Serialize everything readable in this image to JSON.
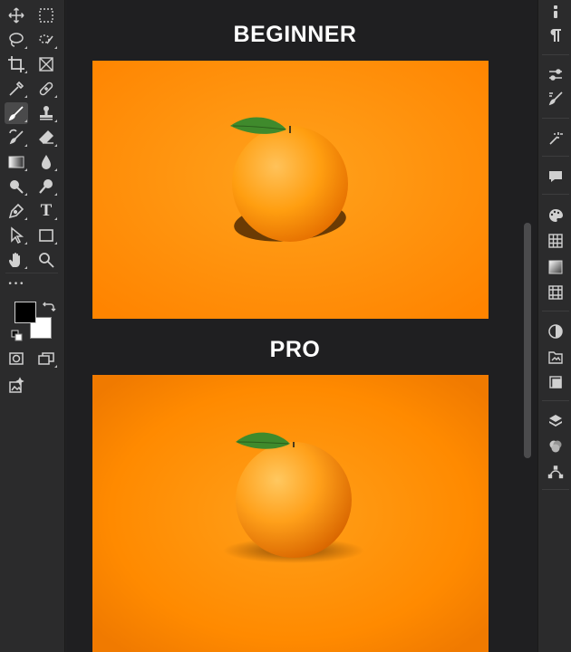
{
  "headings": {
    "beginner": "BEGINNER",
    "pro": "PRO"
  },
  "colors": {
    "canvas_orange": "#ff8a00",
    "foreground": "#000000",
    "background": "#ffffff"
  },
  "toolbar": {
    "tools": [
      {
        "name": "move-tool-icon"
      },
      {
        "name": "rectangular-marquee-icon"
      },
      {
        "name": "lasso-icon"
      },
      {
        "name": "quick-selection-icon"
      },
      {
        "name": "crop-icon"
      },
      {
        "name": "frame-icon"
      },
      {
        "name": "eyedropper-icon"
      },
      {
        "name": "healing-brush-icon"
      },
      {
        "name": "brush-icon"
      },
      {
        "name": "clone-stamp-icon"
      },
      {
        "name": "history-brush-icon"
      },
      {
        "name": "eraser-icon"
      },
      {
        "name": "gradient-icon"
      },
      {
        "name": "blur-icon"
      },
      {
        "name": "dodge-icon"
      },
      {
        "name": "burn-icon"
      },
      {
        "name": "pen-icon"
      },
      {
        "name": "type-icon"
      },
      {
        "name": "path-selection-icon"
      },
      {
        "name": "rectangle-shape-icon"
      },
      {
        "name": "hand-icon"
      },
      {
        "name": "zoom-icon"
      }
    ],
    "type_glyph": "T",
    "more_glyph": "•••"
  }
}
